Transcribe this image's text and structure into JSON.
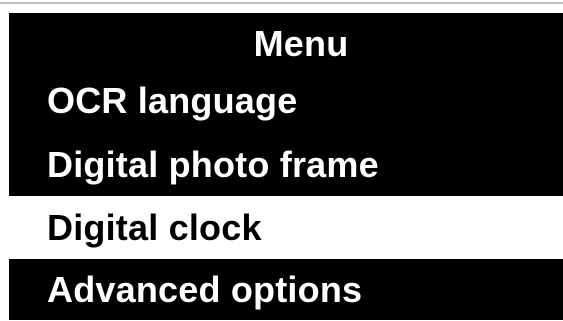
{
  "menu": {
    "title": "Menu",
    "items": [
      {
        "label": "OCR language",
        "selected": false
      },
      {
        "label": "Digital photo frame",
        "selected": false
      },
      {
        "label": "Digital clock",
        "selected": true
      },
      {
        "label": "Advanced options",
        "selected": false
      }
    ]
  },
  "colors": {
    "background": "#000000",
    "text": "#ffffff",
    "selected_background": "#ffffff",
    "selected_text": "#000000"
  }
}
